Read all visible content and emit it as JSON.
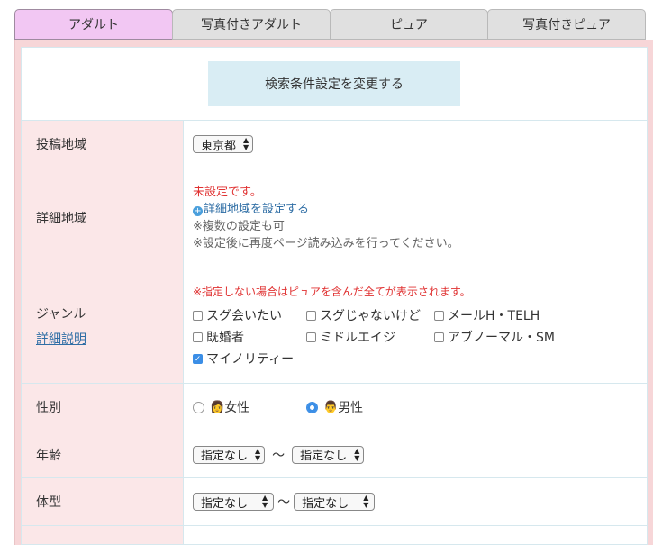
{
  "tabs": [
    {
      "label": "アダルト",
      "active": true
    },
    {
      "label": "写真付きアダルト",
      "active": false
    },
    {
      "label": "ピュア",
      "active": false
    },
    {
      "label": "写真付きピュア",
      "active": false
    }
  ],
  "search_button": "検索条件設定を変更する",
  "area": {
    "label": "投稿地域",
    "value": "東京都"
  },
  "detail_area": {
    "label": "詳細地域",
    "status": "未設定です。",
    "link": "詳細地域を設定する",
    "note1": "※複数の設定も可",
    "note2": "※設定後に再度ページ読み込みを行ってください。"
  },
  "genre": {
    "label": "ジャンル",
    "help_link": "詳細説明",
    "notice": "※指定しない場合はピュアを含んだ全てが表示されます。",
    "options": [
      {
        "label": "スグ会いたい",
        "checked": false
      },
      {
        "label": "スグじゃないけど",
        "checked": false
      },
      {
        "label": "メールH・TELH",
        "checked": false
      },
      {
        "label": "既婚者",
        "checked": false
      },
      {
        "label": "ミドルエイジ",
        "checked": false
      },
      {
        "label": "アブノーマル・SM",
        "checked": false
      },
      {
        "label": "マイノリティー",
        "checked": true
      }
    ]
  },
  "gender": {
    "label": "性別",
    "female": {
      "label": "女性",
      "icon": "woman-emoji-icon",
      "selected": false
    },
    "male": {
      "label": "男性",
      "icon": "man-emoji-icon",
      "selected": true
    }
  },
  "age": {
    "label": "年齢",
    "from": "指定なし",
    "to": "指定なし",
    "separator": "〜"
  },
  "body": {
    "label": "体型",
    "from": "指定なし",
    "to": "指定なし",
    "separator": "〜"
  },
  "colors": {
    "active_tab": "#f2c7f3",
    "label_bg": "#fbe7e8",
    "frame_bg": "#f7d6d8",
    "button_bg": "#d9edf4",
    "accent": "#3b8ee6",
    "warning": "#e03232"
  }
}
